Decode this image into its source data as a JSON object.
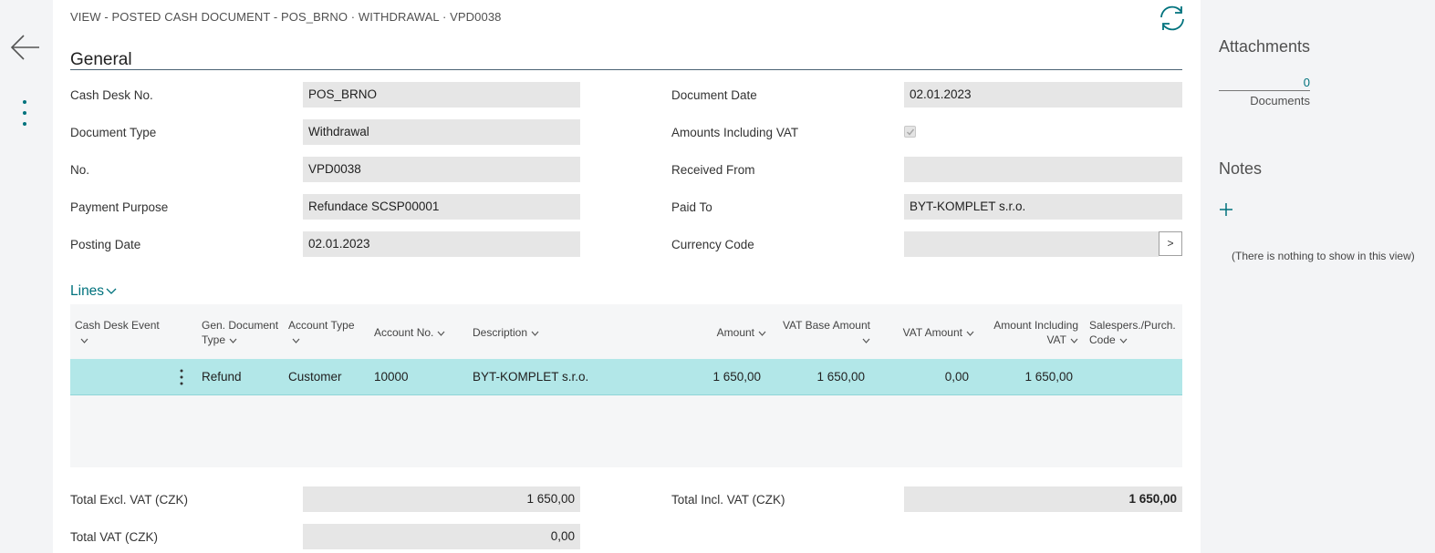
{
  "nav": {
    "back_icon": "arrow-left-icon",
    "more_icon": "vertical-ellipsis-icon",
    "refresh_icon": "refresh-icon"
  },
  "caption": "VIEW - POSTED CASH DOCUMENT - POS_BRNO · WITHDRAWAL · VPD0038",
  "general": {
    "title": "General",
    "cash_desk_no": {
      "label": "Cash Desk No.",
      "value": "POS_BRNO"
    },
    "document_type": {
      "label": "Document Type",
      "value": "Withdrawal"
    },
    "no": {
      "label": "No.",
      "value": "VPD0038"
    },
    "payment_purpose": {
      "label": "Payment Purpose",
      "value": "Refundace SCSP00001"
    },
    "posting_date": {
      "label": "Posting Date",
      "value": "02.01.2023"
    },
    "document_date": {
      "label": "Document Date",
      "value": "02.01.2023"
    },
    "amounts_including_vat": {
      "label": "Amounts Including VAT",
      "checked": true
    },
    "received_from": {
      "label": "Received From",
      "value": ""
    },
    "paid_to": {
      "label": "Paid To",
      "value": "BYT-KOMPLET s.r.o."
    },
    "currency_code": {
      "label": "Currency Code",
      "value": "",
      "assist_label": ">"
    }
  },
  "lines": {
    "title": "Lines",
    "headers": {
      "cash_desk_event": "Cash Desk Event",
      "gen_doc_type_1": "Gen. Document",
      "gen_doc_type_2": "Type",
      "account_type": "Account Type",
      "account_no": "Account No.",
      "description": "Description",
      "amount": "Amount",
      "vat_base_amount": "VAT Base Amount",
      "vat_amount": "VAT Amount",
      "amount_incl_vat_1": "Amount Including",
      "amount_incl_vat_2": "VAT",
      "salespers_1": "Salespers./Purch.",
      "salespers_2": "Code"
    },
    "rows": [
      {
        "cash_desk_event": "",
        "gen_doc_type": "Refund",
        "account_type": "Customer",
        "account_no": "10000",
        "description": "BYT-KOMPLET s.r.o.",
        "amount": "1 650,00",
        "vat_base_amount": "1 650,00",
        "vat_amount": "0,00",
        "amount_incl_vat": "1 650,00",
        "salespers_code": ""
      }
    ]
  },
  "totals": {
    "total_excl_vat": {
      "label": "Total Excl. VAT (CZK)",
      "value": "1 650,00"
    },
    "total_vat": {
      "label": "Total VAT (CZK)",
      "value": "0,00"
    },
    "total_incl_vat": {
      "label": "Total Incl. VAT (CZK)",
      "value": "1 650,00"
    }
  },
  "factbox": {
    "attachments_title": "Attachments",
    "documents_count": "0",
    "documents_label": "Documents",
    "notes_title": "Notes",
    "notes_add_icon": "plus-icon",
    "notes_empty": "(There is nothing to show in this view)"
  },
  "colors": {
    "accent": "#00727d",
    "selected_row": "#b2e7e8",
    "field_bg": "#e6e6e6",
    "pane_bg": "#f3f4f6"
  }
}
